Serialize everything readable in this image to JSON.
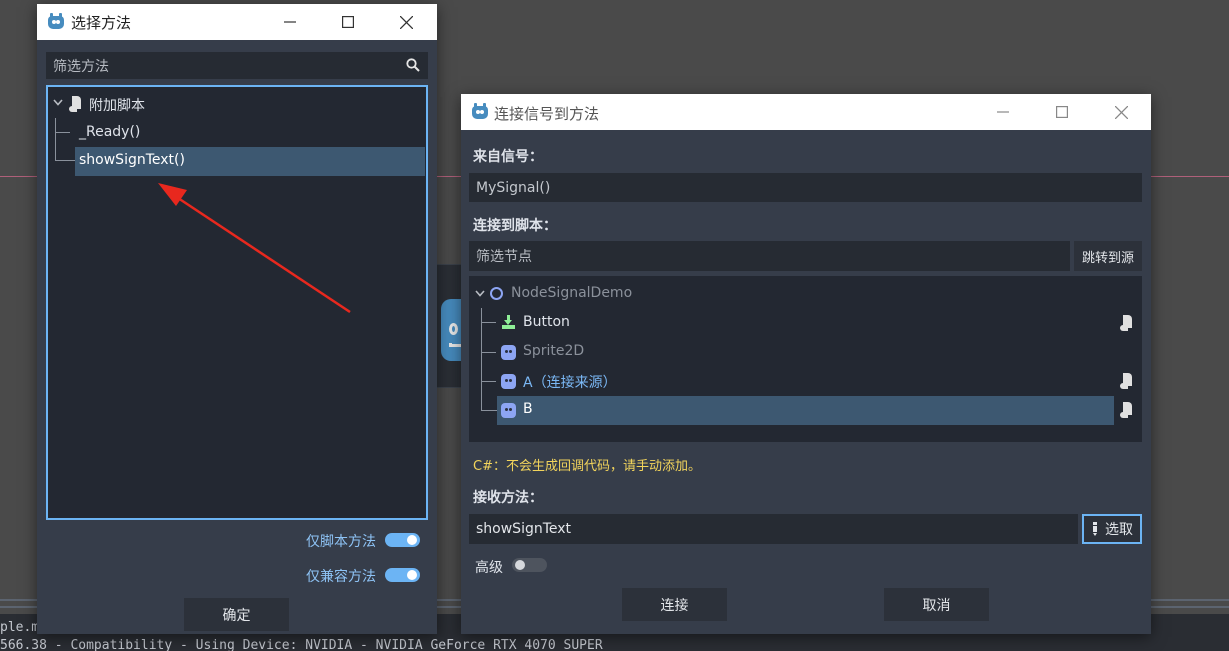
{
  "background": {
    "console_line1": "ple.mc",
    "console_line2": "566.38 - Compatibility - Using Device: NVIDIA - NVIDIA GeForce RTX 4070 SUPER"
  },
  "method_dialog": {
    "title": "选择方法",
    "filter_placeholder": "筛选方法",
    "tree": {
      "root_label": "附加脚本",
      "items": [
        "_Ready()",
        "showSignText()"
      ],
      "selected_index": 1
    },
    "script_only_label": "仅脚本方法",
    "script_only_on": true,
    "compatible_only_label": "仅兼容方法",
    "compatible_only_on": true,
    "ok_label": "确定"
  },
  "connect_dialog": {
    "title": "连接信号到方法",
    "from_signal_label": "来自信号：",
    "signal_value": "MySignal()",
    "connect_to_script_label": "连接到脚本：",
    "filter_nodes_placeholder": "筛选节点",
    "goto_source_label": "跳转到源",
    "nodes": [
      {
        "name": "NodeSignalDemo",
        "icon": "node-circle-icon",
        "dimmed": true,
        "has_script": false
      },
      {
        "name": "Button",
        "icon": "button-node-icon",
        "dimmed": false,
        "has_script": true
      },
      {
        "name": "Sprite2D",
        "icon": "sprite2d-icon",
        "dimmed": true,
        "has_script": false
      },
      {
        "name": "A（连接来源）",
        "icon": "sprite2d-icon",
        "dimmed": false,
        "source": true,
        "has_script": true
      },
      {
        "name": "B",
        "icon": "sprite2d-icon",
        "dimmed": false,
        "selected": true,
        "has_script": true
      }
    ],
    "csharp_warning": "C#：不会生成回调代码，请手动添加。",
    "receiver_method_label": "接收方法：",
    "receiver_method_value": "showSignText",
    "pick_label": "选取",
    "advanced_label": "高级",
    "advanced_on": false,
    "connect_label": "连接",
    "cancel_label": "取消"
  },
  "colors": {
    "panel": "#363d4a",
    "field": "#262b33",
    "accent": "#6cb4f4",
    "selection": "#3d5871",
    "warning": "#f2d45c",
    "arrow": "#e8281e"
  }
}
